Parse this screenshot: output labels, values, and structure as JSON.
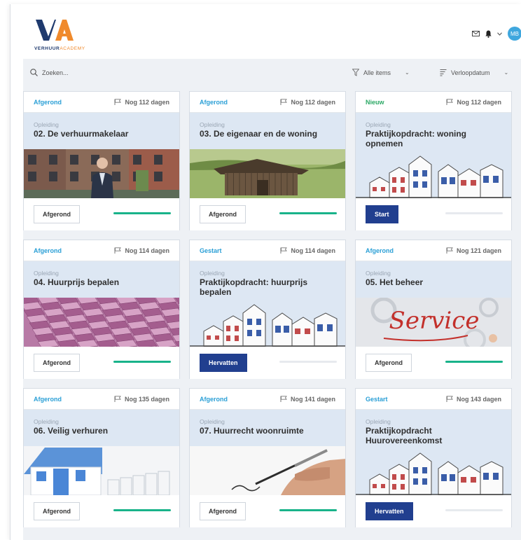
{
  "header": {
    "logo_letters": "VA",
    "logo_text_bold": "VERHUUR",
    "logo_text_light": "ACADEMY",
    "icons": [
      "mail-icon",
      "bell-icon",
      "chevron-down-icon"
    ],
    "avatar_initials": "MB"
  },
  "toolbar": {
    "search_placeholder": "Zoeken...",
    "filter_items_label": "Alle items",
    "sort_label": "Verloopdatum"
  },
  "colors": {
    "accent_blue": "#2a9fd6",
    "new_green": "#2aa864",
    "progress_green": "#19b38a",
    "button_navy": "#213f8f",
    "card_body": "#dde7f3",
    "logo_orange": "#f08a2c",
    "logo_navy": "#1f3a6e"
  },
  "cards": [
    {
      "status": "Afgerond",
      "deadline": "Nog 112 dagen",
      "kind": "Opleiding",
      "title": "02. De verhuurmakelaar",
      "image": "street-man",
      "button": "Afgerond",
      "button_style": "outline",
      "progress": 1.0
    },
    {
      "status": "Afgerond",
      "deadline": "Nog 112 dagen",
      "kind": "Opleiding",
      "title": "03. De eigenaar en de woning",
      "image": "shed",
      "button": "Afgerond",
      "button_style": "outline",
      "progress": 1.0
    },
    {
      "status": "Nieuw",
      "deadline": "Nog 112 dagen",
      "kind": "Opleiding",
      "title": "Praktijkopdracht: woning opnemen",
      "image": "houses",
      "button": "Start",
      "button_style": "solid",
      "progress": 0.0
    },
    {
      "status": "Afgerond",
      "deadline": "Nog 114 dagen",
      "kind": "Opleiding",
      "title": "04. Huurprijs bepalen",
      "image": "banknotes",
      "button": "Afgerond",
      "button_style": "outline",
      "progress": 1.0
    },
    {
      "status": "Gestart",
      "deadline": "Nog 114 dagen",
      "kind": "Opleiding",
      "title": "Praktijkopdracht: huurprijs bepalen",
      "image": "houses",
      "button": "Hervatten",
      "button_style": "solid",
      "progress": 0.0
    },
    {
      "status": "Afgerond",
      "deadline": "Nog 121 dagen",
      "kind": "Opleiding",
      "title": "05. Het beheer",
      "image": "service",
      "image_text": "Service",
      "button": "Afgerond",
      "button_style": "outline",
      "progress": 1.0
    },
    {
      "status": "Afgerond",
      "deadline": "Nog 135 dagen",
      "kind": "Opleiding",
      "title": "06. Veilig verhuren",
      "image": "house-model",
      "button": "Afgerond",
      "button_style": "outline",
      "progress": 1.0
    },
    {
      "status": "Afgerond",
      "deadline": "Nog 141 dagen",
      "kind": "Opleiding",
      "title": "07. Huurrecht woonruimte",
      "image": "pen-signing",
      "button": "Afgerond",
      "button_style": "outline",
      "progress": 1.0
    },
    {
      "status": "Gestart",
      "deadline": "Nog 143 dagen",
      "kind": "Opleiding",
      "title": "Praktijkopdracht Huurovereenkomst",
      "image": "houses",
      "button": "Hervatten",
      "button_style": "solid",
      "progress": 0.0
    }
  ]
}
